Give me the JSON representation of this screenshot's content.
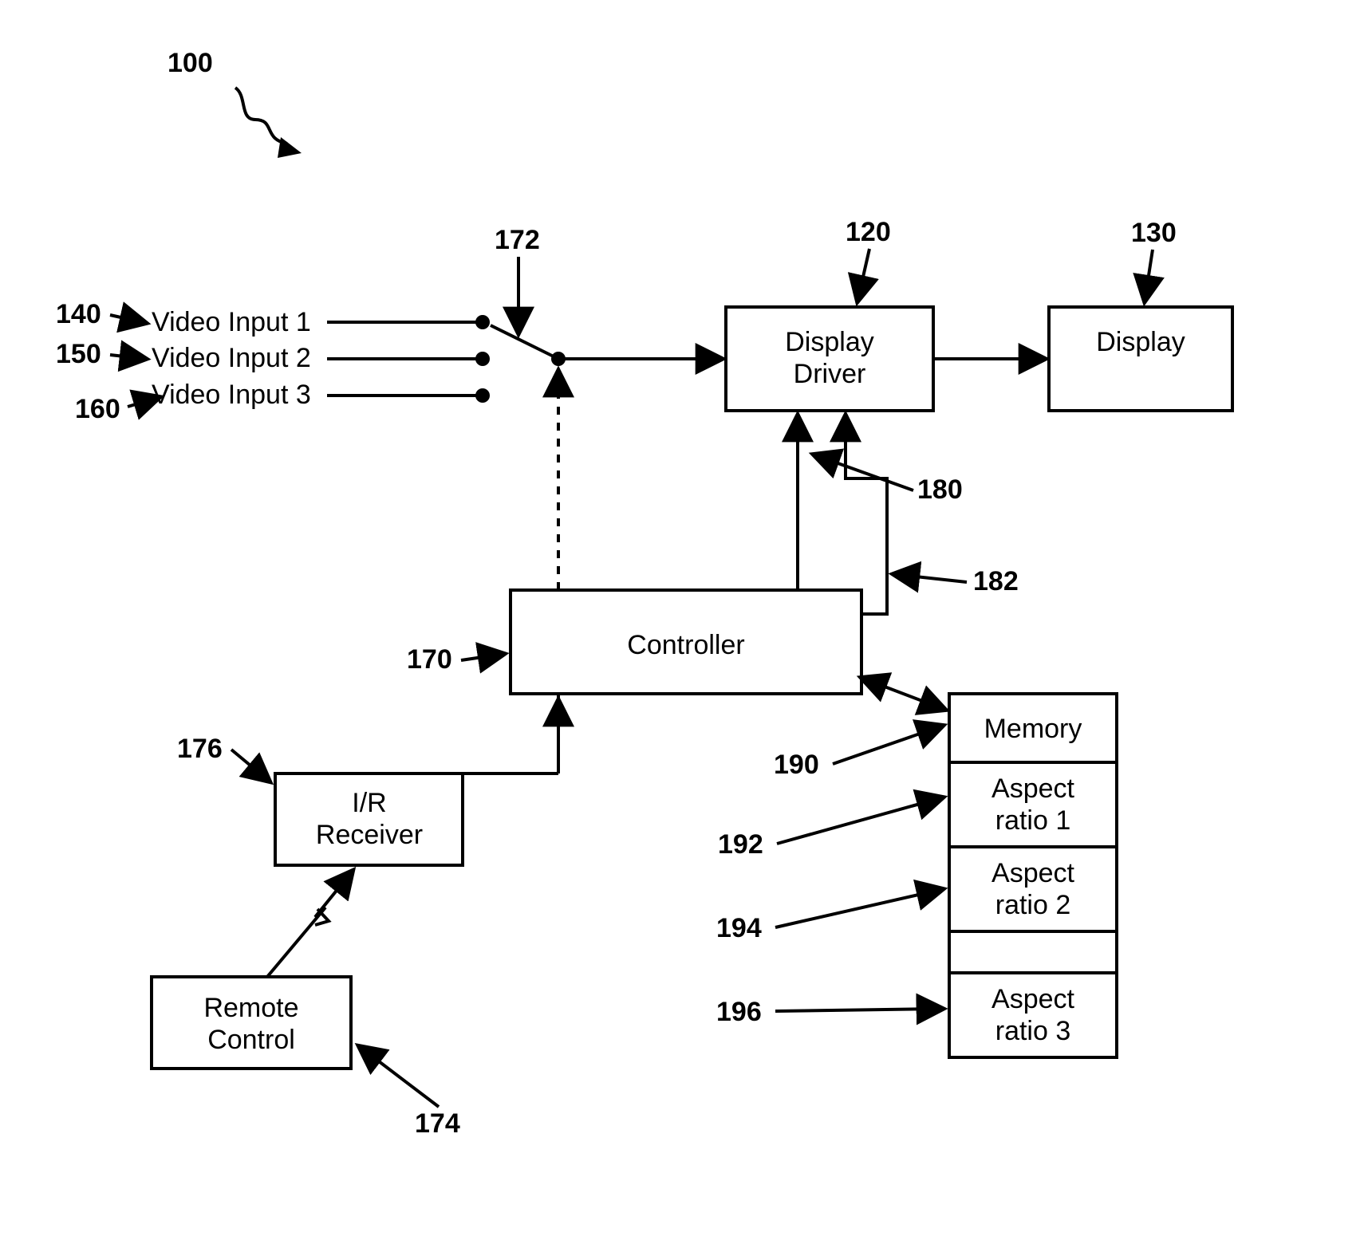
{
  "figure_ref": "100",
  "labels": {
    "l140": "140",
    "l150": "150",
    "l160": "160",
    "l172": "172",
    "l120": "120",
    "l130": "130",
    "l180": "180",
    "l182": "182",
    "l170": "170",
    "l176": "176",
    "l174": "174",
    "l190": "190",
    "l192": "192",
    "l194": "194",
    "l196": "196"
  },
  "inputs": {
    "in1": "Video Input 1",
    "in2": "Video Input 2",
    "in3": "Video Input 3"
  },
  "blocks": {
    "display_driver_l1": "Display",
    "display_driver_l2": "Driver",
    "display": "Display",
    "controller": "Controller",
    "ir_l1": "I/R",
    "ir_l2": "Receiver",
    "remote_l1": "Remote",
    "remote_l2": "Control",
    "memory": "Memory",
    "ar1_l1": "Aspect",
    "ar1_l2": "ratio 1",
    "ar2_l1": "Aspect",
    "ar2_l2": "ratio 2",
    "ar3_l1": "Aspect",
    "ar3_l2": "ratio 3"
  }
}
